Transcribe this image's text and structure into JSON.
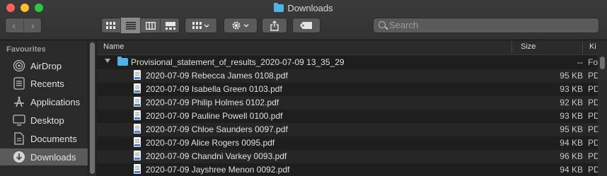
{
  "window": {
    "title": "Downloads"
  },
  "toolbar": {
    "back_icon": "chevron-left-icon",
    "forward_icon": "chevron-right-icon",
    "view_modes": [
      "icon-view",
      "list-view",
      "column-view",
      "gallery-view"
    ],
    "active_view": "list-view",
    "search_placeholder": "Search"
  },
  "sidebar": {
    "heading": "Favourites",
    "items": [
      {
        "label": "AirDrop",
        "icon": "airdrop-icon"
      },
      {
        "label": "Recents",
        "icon": "recents-icon"
      },
      {
        "label": "Applications",
        "icon": "applications-icon"
      },
      {
        "label": "Desktop",
        "icon": "desktop-icon"
      },
      {
        "label": "Documents",
        "icon": "documents-icon"
      },
      {
        "label": "Downloads",
        "icon": "downloads-icon",
        "active": true
      }
    ]
  },
  "list": {
    "columns": {
      "name": "Name",
      "size": "Size",
      "kind": "Ki"
    },
    "folder": {
      "name": "Provisional_statement_of_results_2020-07-09 13_35_29",
      "size": "--",
      "kind": "Fo"
    },
    "files": [
      {
        "name": "2020-07-09 Rebecca James 0108.pdf",
        "size": "95 KB",
        "kind": "PD"
      },
      {
        "name": "2020-07-09 Isabella Green 0103.pdf",
        "size": "93 KB",
        "kind": "PD"
      },
      {
        "name": "2020-07-09 Philip Holmes 0102.pdf",
        "size": "92 KB",
        "kind": "PD"
      },
      {
        "name": "2020-07-09 Pauline Powell 0100.pdf",
        "size": "93 KB",
        "kind": "PD"
      },
      {
        "name": "2020-07-09 Chloe Saunders 0097.pdf",
        "size": "95 KB",
        "kind": "PD"
      },
      {
        "name": "2020-07-09 Alice Rogers 0095.pdf",
        "size": "94 KB",
        "kind": "PD"
      },
      {
        "name": "2020-07-09 Chandni Varkey 0093.pdf",
        "size": "96 KB",
        "kind": "PD"
      },
      {
        "name": "2020-07-09 Jayshree Menon 0092.pdf",
        "size": "94 KB",
        "kind": "PD"
      }
    ]
  }
}
